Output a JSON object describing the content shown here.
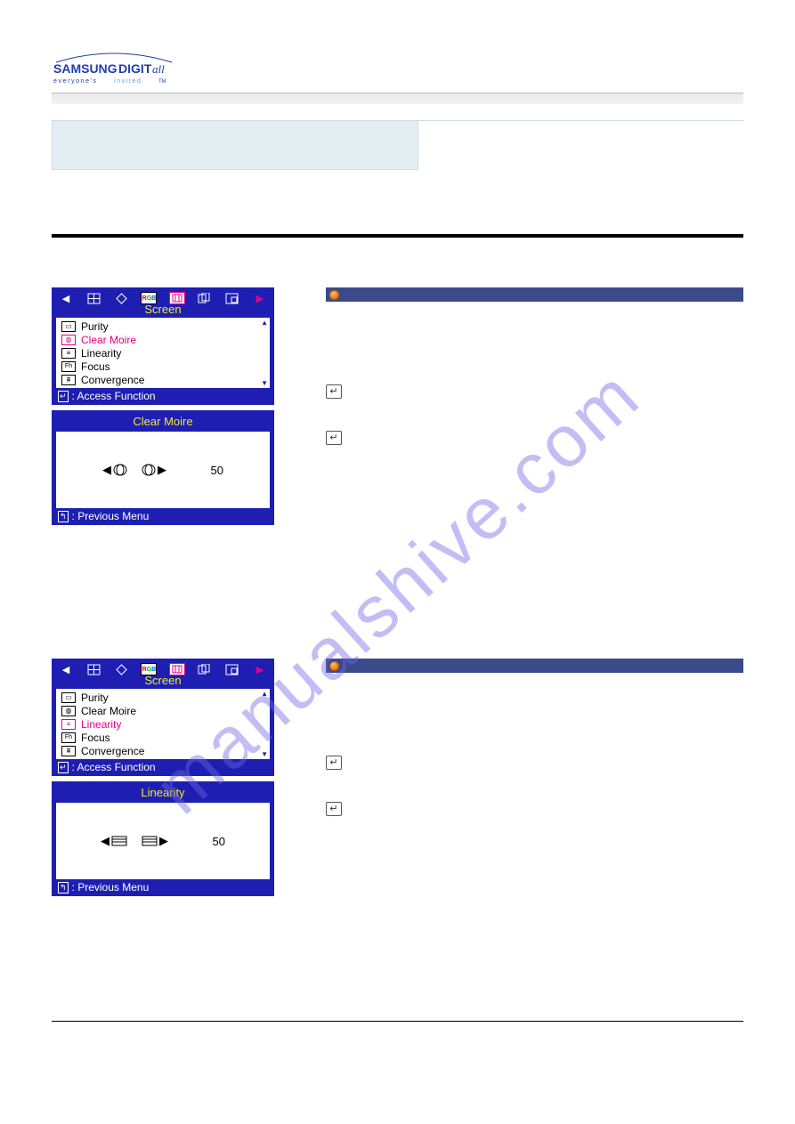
{
  "logo": {
    "brand_main": "SAMSUNG",
    "brand_sub": "DIGIT",
    "brand_suffix": "all",
    "tagline_1": "everyone's",
    "tagline_2": "invited"
  },
  "section1": {
    "osd": {
      "title": "Screen",
      "items": [
        {
          "label": "Purity"
        },
        {
          "label": "Clear Moire"
        },
        {
          "label": "Linearity"
        },
        {
          "label": "Focus"
        },
        {
          "label": "Convergence"
        }
      ],
      "footer": ": Access Function",
      "selected_index": 1
    },
    "adjust": {
      "title": "Clear Moire",
      "value": "50",
      "footer": ": Previous Menu"
    }
  },
  "section2": {
    "osd": {
      "title": "Screen",
      "items": [
        {
          "label": "Purity"
        },
        {
          "label": "Clear Moire"
        },
        {
          "label": "Linearity"
        },
        {
          "label": "Focus"
        },
        {
          "label": "Convergence"
        }
      ],
      "footer": ": Access Function",
      "selected_index": 2
    },
    "adjust": {
      "title": "Linearity",
      "value": "50",
      "footer": ": Previous Menu"
    }
  },
  "watermark": "manualshive.com"
}
